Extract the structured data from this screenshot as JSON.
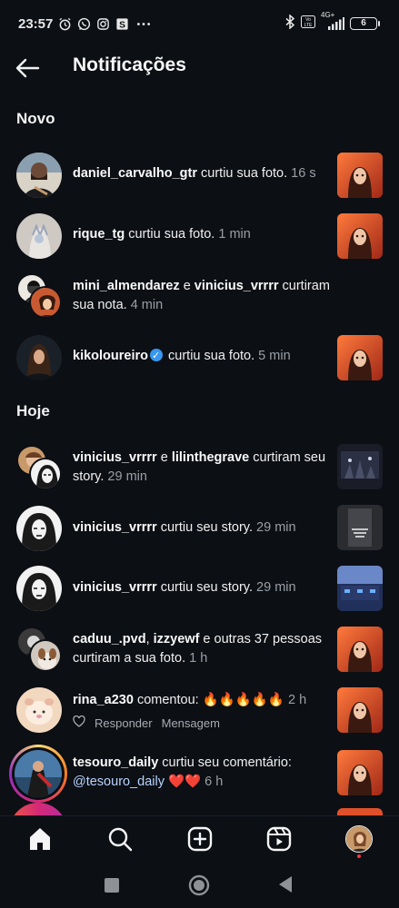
{
  "status_bar": {
    "time": "23:57",
    "battery": "6",
    "network": "4G+",
    "icons": [
      "alarm-icon",
      "whatsapp-icon",
      "instagram-icon",
      "s-app-icon",
      "more-dots-icon",
      "bluetooth-icon",
      "volte-icon",
      "signal-icon",
      "battery-icon"
    ]
  },
  "header": {
    "title": "Notificações",
    "back_icon": "arrow-left-icon"
  },
  "sections": {
    "new": "Novo",
    "today": "Hoje"
  },
  "notifications": {
    "n1": {
      "user": "daniel_carvalho_gtr",
      "text": " curtiu sua foto. ",
      "time": "16 s"
    },
    "n2": {
      "user": "rique_tg",
      "text": " curtiu sua foto. ",
      "time": "1 min"
    },
    "n3": {
      "user1": "mini_almendarez",
      "join": " e ",
      "user2": "vinicius_vrrrr",
      "text": " curtiram sua nota. ",
      "time": "4 min"
    },
    "n4": {
      "user": "kikoloureiro",
      "text": " curtiu sua foto. ",
      "time": "5 min"
    },
    "n5": {
      "user1": "vinicius_vrrrr",
      "join": " e ",
      "user2": "lilinthegrave",
      "text": " curtiram seu story. ",
      "time": "29 min"
    },
    "n6": {
      "user": "vinicius_vrrrr",
      "text": " curtiu seu story. ",
      "time": "29 min"
    },
    "n7": {
      "user": "vinicius_vrrrr",
      "text": " curtiu seu story. ",
      "time": "29 min"
    },
    "n8": {
      "user1": "caduu_.pvd",
      "join": ", ",
      "user2": "izzyewf",
      "text": " e outras 37 pessoas curtiram a sua foto. ",
      "time": "1 h"
    },
    "n9": {
      "user": "rina_a230",
      "text": " comentou: 🔥🔥🔥🔥🔥 ",
      "time": "2 h",
      "reply": "Responder",
      "message": "Mensagem"
    },
    "n10": {
      "user": "tesouro_daily",
      "text": " curtiu seu comentário: ",
      "mention": "@tesouro_daily",
      "hearts": " ❤️❤️ ",
      "time": "6 h"
    }
  },
  "bottom_nav": [
    "home-icon",
    "search-icon",
    "create-icon",
    "reels-icon",
    "profile-avatar"
  ],
  "colors": {
    "background": "#0c0f14",
    "secondary_text": "#9aa0a6",
    "verified": "#3897f0",
    "badge": "#ff3040"
  }
}
